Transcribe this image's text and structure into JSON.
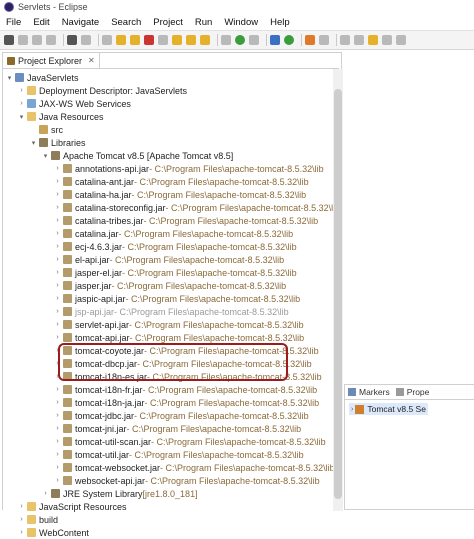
{
  "window": {
    "title": "Servlets - Eclipse"
  },
  "menu": [
    "File",
    "Edit",
    "Navigate",
    "Search",
    "Project",
    "Run",
    "Window",
    "Help"
  ],
  "project_explorer": {
    "tab_label": "Project Explorer",
    "close_glyph": "✕",
    "tree": [
      {
        "label": "JavaServlets",
        "icon": "project-icon",
        "expanded": true,
        "depth": 0
      },
      {
        "label": "Deployment Descriptor: JavaServlets",
        "icon": "descriptor-icon",
        "expanded": false,
        "depth": 1
      },
      {
        "label": "JAX-WS Web Services",
        "icon": "webservices-icon",
        "expanded": false,
        "depth": 1
      },
      {
        "label": "Java Resources",
        "icon": "folder-icon",
        "expanded": true,
        "depth": 1
      },
      {
        "label": "src",
        "icon": "package-folder-icon",
        "expanded": null,
        "depth": 2
      },
      {
        "label": "Libraries",
        "icon": "libraries-icon",
        "expanded": true,
        "depth": 2
      },
      {
        "label": "Apache Tomcat v8.5 [Apache Tomcat v8.5]",
        "icon": "library-icon",
        "expanded": true,
        "depth": 3
      }
    ],
    "jars": [
      {
        "name": "annotations-api.jar",
        "path": " - C:\\Program Files\\apache-tomcat-8.5.32\\lib"
      },
      {
        "name": "catalina-ant.jar",
        "path": " - C:\\Program Files\\apache-tomcat-8.5.32\\lib"
      },
      {
        "name": "catalina-ha.jar",
        "path": " - C:\\Program Files\\apache-tomcat-8.5.32\\lib"
      },
      {
        "name": "catalina-storeconfig.jar",
        "path": " - C:\\Program Files\\apache-tomcat-8.5.32\\lib"
      },
      {
        "name": "catalina-tribes.jar",
        "path": " - C:\\Program Files\\apache-tomcat-8.5.32\\lib"
      },
      {
        "name": "catalina.jar",
        "path": " - C:\\Program Files\\apache-tomcat-8.5.32\\lib"
      },
      {
        "name": "ecj-4.6.3.jar",
        "path": " - C:\\Program Files\\apache-tomcat-8.5.32\\lib"
      },
      {
        "name": "el-api.jar",
        "path": " - C:\\Program Files\\apache-tomcat-8.5.32\\lib"
      },
      {
        "name": "jasper-el.jar",
        "path": " - C:\\Program Files\\apache-tomcat-8.5.32\\lib"
      },
      {
        "name": "jasper.jar",
        "path": " - C:\\Program Files\\apache-tomcat-8.5.32\\lib"
      },
      {
        "name": "jaspic-api.jar",
        "path": " - C:\\Program Files\\apache-tomcat-8.5.32\\lib"
      },
      {
        "name": "jsp-api.jar",
        "path": " - C:\\Program Files\\apache-tomcat-8.5.32\\lib"
      },
      {
        "name": "servlet-api.jar",
        "path": " - C:\\Program Files\\apache-tomcat-8.5.32\\lib"
      },
      {
        "name": "tomcat-api.jar",
        "path": " - C:\\Program Files\\apache-tomcat-8.5.32\\lib"
      },
      {
        "name": "tomcat-coyote.jar",
        "path": " - C:\\Program Files\\apache-tomcat-8.5.32\\lib"
      },
      {
        "name": "tomcat-dbcp.jar",
        "path": " - C:\\Program Files\\apache-tomcat-8.5.32\\lib"
      },
      {
        "name": "tomcat-i18n-es.jar",
        "path": " - C:\\Program Files\\apache-tomcat-8.5.32\\lib"
      },
      {
        "name": "tomcat-i18n-fr.jar",
        "path": " - C:\\Program Files\\apache-tomcat-8.5.32\\lib"
      },
      {
        "name": "tomcat-i18n-ja.jar",
        "path": " - C:\\Program Files\\apache-tomcat-8.5.32\\lib"
      },
      {
        "name": "tomcat-jdbc.jar",
        "path": " - C:\\Program Files\\apache-tomcat-8.5.32\\lib"
      },
      {
        "name": "tomcat-jni.jar",
        "path": " - C:\\Program Files\\apache-tomcat-8.5.32\\lib"
      },
      {
        "name": "tomcat-util-scan.jar",
        "path": " - C:\\Program Files\\apache-tomcat-8.5.32\\lib"
      },
      {
        "name": "tomcat-util.jar",
        "path": " - C:\\Program Files\\apache-tomcat-8.5.32\\lib"
      },
      {
        "name": "tomcat-websocket.jar",
        "path": " - C:\\Program Files\\apache-tomcat-8.5.32\\lib"
      },
      {
        "name": "websocket-api.jar",
        "path": " - C:\\Program Files\\apache-tomcat-8.5.32\\lib"
      }
    ],
    "tail": [
      {
        "label": "JRE System Library",
        "suffix": " [jre1.8.0_181]",
        "icon": "library-icon",
        "depth": 3
      },
      {
        "label": "JavaScript Resources",
        "suffix": "",
        "icon": "folder-icon",
        "depth": 1
      },
      {
        "label": "build",
        "suffix": "",
        "icon": "folder-icon",
        "depth": 1
      },
      {
        "label": "WebContent",
        "suffix": "",
        "icon": "folder-icon",
        "depth": 1
      }
    ]
  },
  "servers_panel": {
    "tabs": [
      "Markers",
      "Prope"
    ],
    "server": "Tomcat v8.5 Se"
  }
}
